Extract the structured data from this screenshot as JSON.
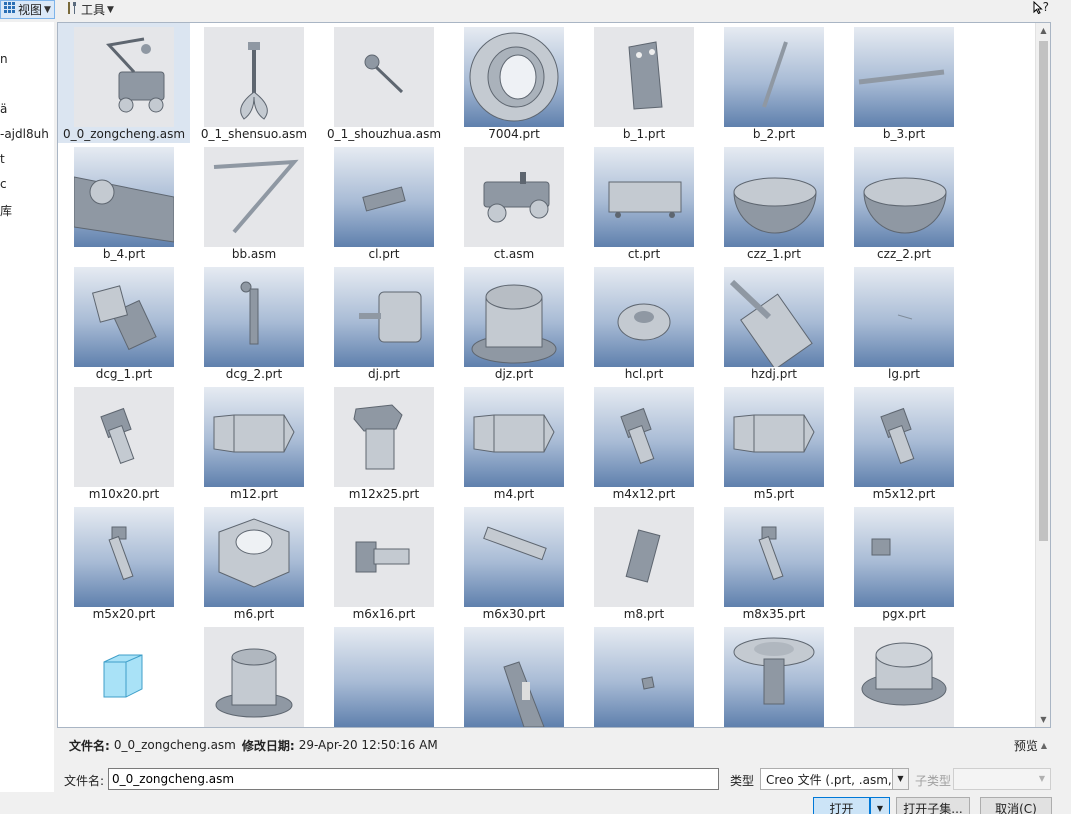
{
  "toolbar": {
    "view_label": "视图",
    "tools_label": "工具",
    "help_label": "?"
  },
  "sidebar": {
    "items": [
      {
        "label": "n"
      },
      {
        "label": "ä"
      },
      {
        "label": "-ajdl8uh"
      },
      {
        "label": "t"
      },
      {
        "label": "c"
      },
      {
        "label": "库"
      }
    ]
  },
  "files": [
    {
      "name": "0_0_zongcheng.asm",
      "bg": "flat",
      "icon": "assembly-crane-cart"
    },
    {
      "name": "0_1_shensuo.asm",
      "bg": "flat",
      "icon": "telescopic-gripper"
    },
    {
      "name": "0_1_shouzhua.asm",
      "bg": "flat",
      "icon": "ball-gripper"
    },
    {
      "name": "7004.prt",
      "bg": "grad",
      "icon": "bearing"
    },
    {
      "name": "b_1.prt",
      "bg": "flat",
      "icon": "plate-bracket"
    },
    {
      "name": "b_2.prt",
      "bg": "grad",
      "icon": "thin-rod"
    },
    {
      "name": "b_3.prt",
      "bg": "grad",
      "icon": "flat-bar"
    },
    {
      "name": "b_4.prt",
      "bg": "grad",
      "icon": "arm-link"
    },
    {
      "name": "bb.asm",
      "bg": "flat",
      "icon": "bent-arm"
    },
    {
      "name": "cl.prt",
      "bg": "grad",
      "icon": "gear"
    },
    {
      "name": "ct.asm",
      "bg": "flat",
      "icon": "cart"
    },
    {
      "name": "ct.prt",
      "bg": "grad",
      "icon": "chassis-plate"
    },
    {
      "name": "czz_1.prt",
      "bg": "grad",
      "icon": "hemisphere"
    },
    {
      "name": "czz_2.prt",
      "bg": "grad",
      "icon": "hemisphere"
    },
    {
      "name": "dcg_1.prt",
      "bg": "grad",
      "icon": "cylinder-flange"
    },
    {
      "name": "dcg_2.prt",
      "bg": "grad",
      "icon": "rod-eye"
    },
    {
      "name": "dj.prt",
      "bg": "grad",
      "icon": "motor"
    },
    {
      "name": "djz.prt",
      "bg": "grad",
      "icon": "motor-mount"
    },
    {
      "name": "hcl.prt",
      "bg": "grad",
      "icon": "disc"
    },
    {
      "name": "hzdj.prt",
      "bg": "grad",
      "icon": "big-motor"
    },
    {
      "name": "lg.prt",
      "bg": "grad",
      "icon": "tiny-line"
    },
    {
      "name": "m10x20.prt",
      "bg": "flat",
      "icon": "bolt"
    },
    {
      "name": "m12.prt",
      "bg": "grad",
      "icon": "hex-nut-side"
    },
    {
      "name": "m12x25.prt",
      "bg": "flat",
      "icon": "hex-bolt"
    },
    {
      "name": "m4.prt",
      "bg": "grad",
      "icon": "hex-nut-side"
    },
    {
      "name": "m4x12.prt",
      "bg": "grad",
      "icon": "bolt"
    },
    {
      "name": "m5.prt",
      "bg": "grad",
      "icon": "hex-nut-side"
    },
    {
      "name": "m5x12.prt",
      "bg": "grad",
      "icon": "bolt"
    },
    {
      "name": "m5x20.prt",
      "bg": "grad",
      "icon": "long-bolt"
    },
    {
      "name": "m6.prt",
      "bg": "grad",
      "icon": "hex-nut-top"
    },
    {
      "name": "m6x16.prt",
      "bg": "flat",
      "icon": "side-bolt"
    },
    {
      "name": "m6x30.prt",
      "bg": "grad",
      "icon": "long-side-bolt"
    },
    {
      "name": "m8.prt",
      "bg": "flat",
      "icon": "block"
    },
    {
      "name": "m8x35.prt",
      "bg": "grad",
      "icon": "long-bolt"
    },
    {
      "name": "pgx.prt",
      "bg": "grad",
      "icon": "small-cube"
    },
    {
      "name": "",
      "bg": "white",
      "icon": "blue-cube"
    },
    {
      "name": "",
      "bg": "flat",
      "icon": "flanged-housing"
    },
    {
      "name": "",
      "bg": "grad",
      "icon": "empty"
    },
    {
      "name": "",
      "bg": "grad",
      "icon": "frame-arm"
    },
    {
      "name": "",
      "bg": "grad",
      "icon": "tiny-nut"
    },
    {
      "name": "",
      "bg": "grad",
      "icon": "pulley-shaft"
    },
    {
      "name": "",
      "bg": "flat",
      "icon": "flange-ring"
    }
  ],
  "info": {
    "filename_label": "文件名:",
    "filename_value": "0_0_zongcheng.asm",
    "modified_label": "修改日期:",
    "modified_value": "29-Apr-20 12:50:16 AM",
    "preview_label": "预览"
  },
  "form": {
    "filename_label": "文件名:",
    "filename_value": "0_0_zongcheng.asm",
    "type_label": "类型",
    "type_value": "Creo 文件 (.prt, .asm,",
    "subtype_label": "子类型"
  },
  "buttons": {
    "open": "打开",
    "open_sub": "打开子集...",
    "cancel": "取消(C)"
  }
}
